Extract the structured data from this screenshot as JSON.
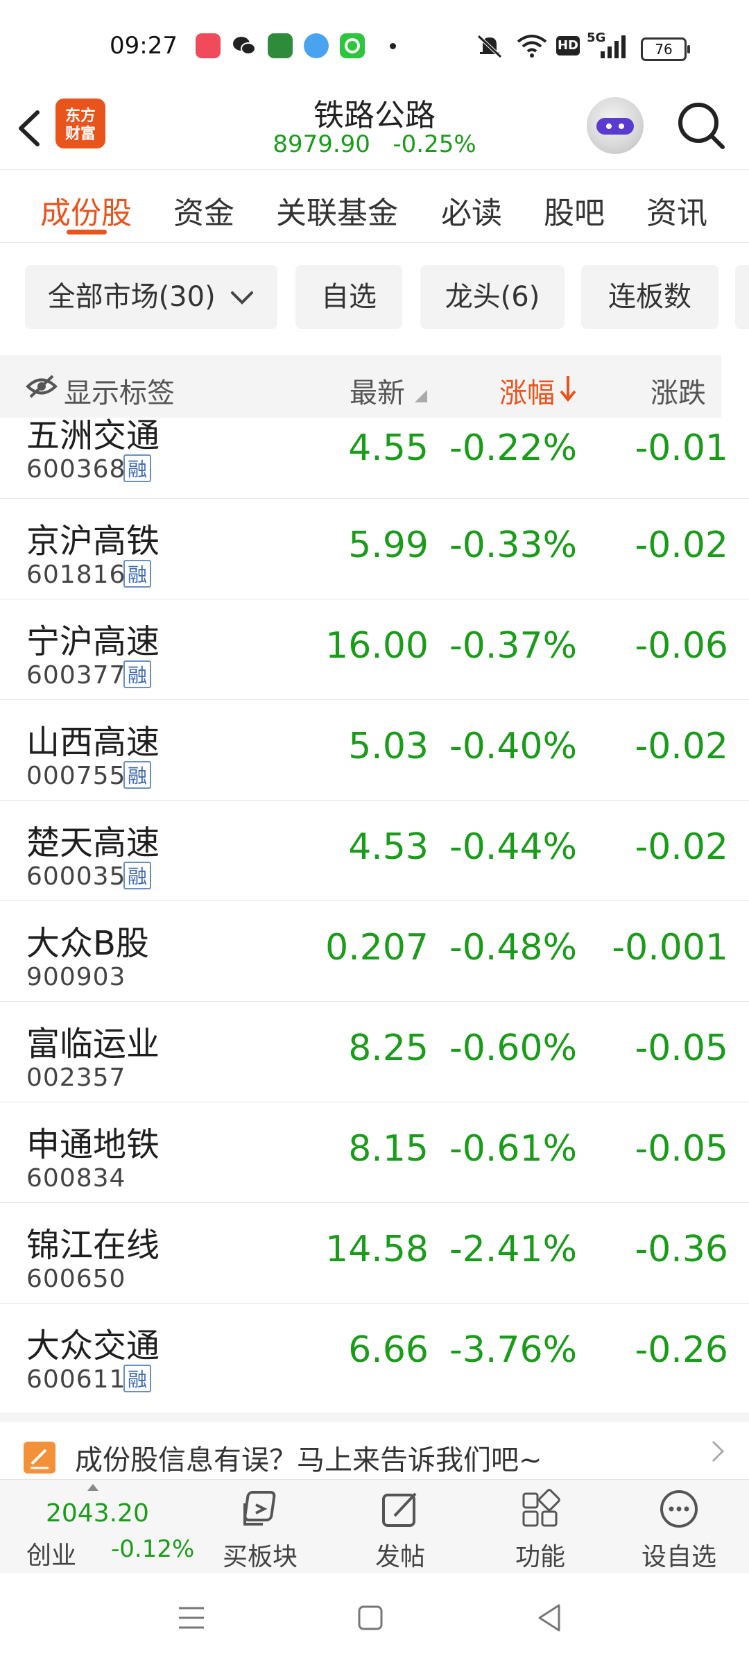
{
  "status_bar": {
    "time": "09:27",
    "battery": "76",
    "network": "5G"
  },
  "header": {
    "title": "铁路公路",
    "index_value": "8979.90",
    "index_change": "-0.25%",
    "logo_text": "东方财富"
  },
  "tabs": [
    {
      "label": "成份股",
      "active": true
    },
    {
      "label": "资金"
    },
    {
      "label": "关联基金"
    },
    {
      "label": "必读"
    },
    {
      "label": "股吧"
    },
    {
      "label": "资讯"
    }
  ],
  "filters": {
    "market": "全部市场(30)",
    "watchlist": "自选",
    "leaders": "龙头(6)",
    "streak": "连板数"
  },
  "columns": {
    "show_tags": "显示标签",
    "latest": "最新",
    "change_pct": "涨幅",
    "change": "涨跌"
  },
  "stocks": [
    {
      "name": "五洲交通",
      "code": "600368",
      "margin": "融",
      "price": "4.55",
      "pct": "-0.22%",
      "chg": "-0.01"
    },
    {
      "name": "京沪高铁",
      "code": "601816",
      "margin": "融",
      "price": "5.99",
      "pct": "-0.33%",
      "chg": "-0.02"
    },
    {
      "name": "宁沪高速",
      "code": "600377",
      "margin": "融",
      "price": "16.00",
      "pct": "-0.37%",
      "chg": "-0.06"
    },
    {
      "name": "山西高速",
      "code": "000755",
      "margin": "融",
      "price": "5.03",
      "pct": "-0.40%",
      "chg": "-0.02"
    },
    {
      "name": "楚天高速",
      "code": "600035",
      "margin": "融",
      "price": "4.53",
      "pct": "-0.44%",
      "chg": "-0.02"
    },
    {
      "name": "大众B股",
      "code": "900903",
      "margin": "",
      "price": "0.207",
      "pct": "-0.48%",
      "chg": "-0.001"
    },
    {
      "name": "富临运业",
      "code": "002357",
      "margin": "",
      "price": "8.25",
      "pct": "-0.60%",
      "chg": "-0.05"
    },
    {
      "name": "申通地铁",
      "code": "600834",
      "margin": "",
      "price": "8.15",
      "pct": "-0.61%",
      "chg": "-0.05"
    },
    {
      "name": "锦江在线",
      "code": "600650",
      "margin": "",
      "price": "14.58",
      "pct": "-2.41%",
      "chg": "-0.36"
    },
    {
      "name": "大众交通",
      "code": "600611",
      "margin": "融",
      "price": "6.66",
      "pct": "-3.76%",
      "chg": "-0.26"
    }
  ],
  "feedback": {
    "text": "成份股信息有误？马上来告诉我们吧~"
  },
  "bottom_bar": {
    "index_value": "2043.20",
    "index_name": "创业",
    "index_change": "-0.12%",
    "buy_sector": "买板块",
    "post": "发帖",
    "functions": "功能",
    "add_watch": "设自选"
  },
  "colors": {
    "accent": "#e8541c",
    "down": "#1a9c1a",
    "badge": "#3d69b0"
  }
}
